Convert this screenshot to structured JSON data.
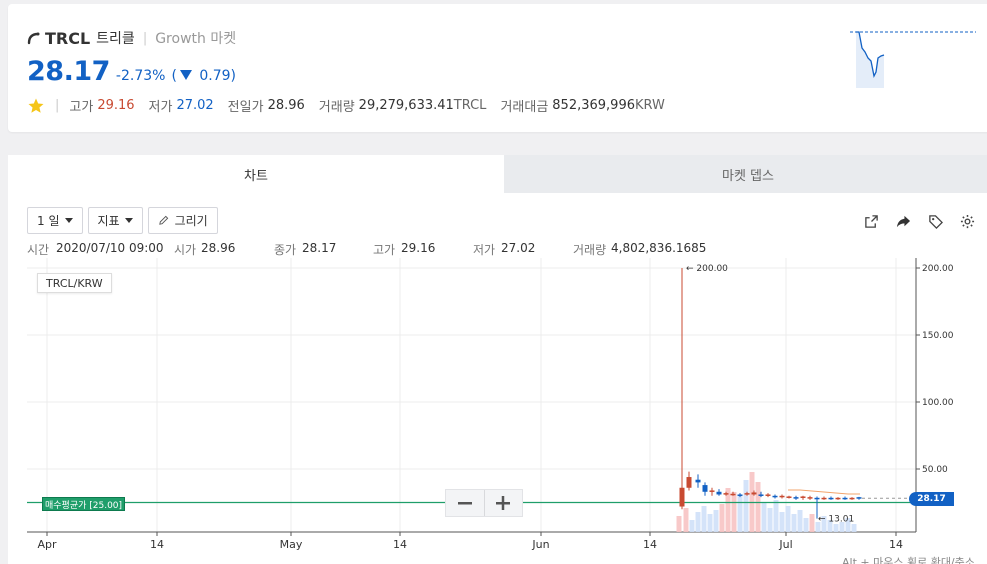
{
  "coin": {
    "symbol": "TRCL",
    "name": "트리클",
    "market": "Growth 마켓",
    "price": "28.17",
    "change_pct": "-2.73%",
    "change_abs": "0.79",
    "change_paren_open": "(",
    "change_paren_close": ")",
    "stats": {
      "high_label": "고가",
      "high": "29.16",
      "low_label": "저가",
      "low": "27.02",
      "prev_label": "전일가",
      "prev": "28.96",
      "volume_label": "거래량",
      "volume": "29,279,633.41",
      "volume_unit": "TRCL",
      "amount_label": "거래대금",
      "amount": "852,369,996",
      "amount_unit": "KRW"
    }
  },
  "tabs": [
    {
      "label": "차트",
      "active": true
    },
    {
      "label": "마켓 뎁스",
      "active": false
    }
  ],
  "toolbar": {
    "interval": "1 일",
    "indicator": "지표",
    "draw": "그리기"
  },
  "ohlc": {
    "time_label": "시간",
    "time": "2020/07/10 09:00",
    "open_label": "시가",
    "open": "28.96",
    "close_label": "종가",
    "close": "28.17",
    "high_label": "고가",
    "high": "29.16",
    "low_label": "저가",
    "low": "27.02",
    "volume_label": "거래량",
    "volume": "4,802,836.1685"
  },
  "pair_label": "TRCL/KRW",
  "avg_buy_label": "매수평균가 [25.00]",
  "last_price_tag": "28.17",
  "hint": "Alt + 마우스 휠로 확대/축소",
  "colors": {
    "up": "#c84a31",
    "down": "#1261c4",
    "avg_line": "#1f9e6a"
  },
  "icons": [
    "star-icon",
    "fullscreen-icon",
    "share-icon",
    "tag-icon",
    "gear-icon",
    "pencil-icon",
    "minus-icon",
    "plus-icon"
  ],
  "chart_data": {
    "type": "candlestick",
    "x_ticks": [
      "Apr",
      "14",
      "May",
      "14",
      "Jun",
      "14",
      "Jul",
      "14"
    ],
    "y_ticks": [
      "200.00",
      "150.00",
      "100.00",
      "50.00"
    ],
    "annotations": [
      "← 200.00",
      "← 13.01"
    ],
    "avg_buy_price": 25.0,
    "last_price": 28.17,
    "ylim": [
      7,
      203
    ]
  }
}
